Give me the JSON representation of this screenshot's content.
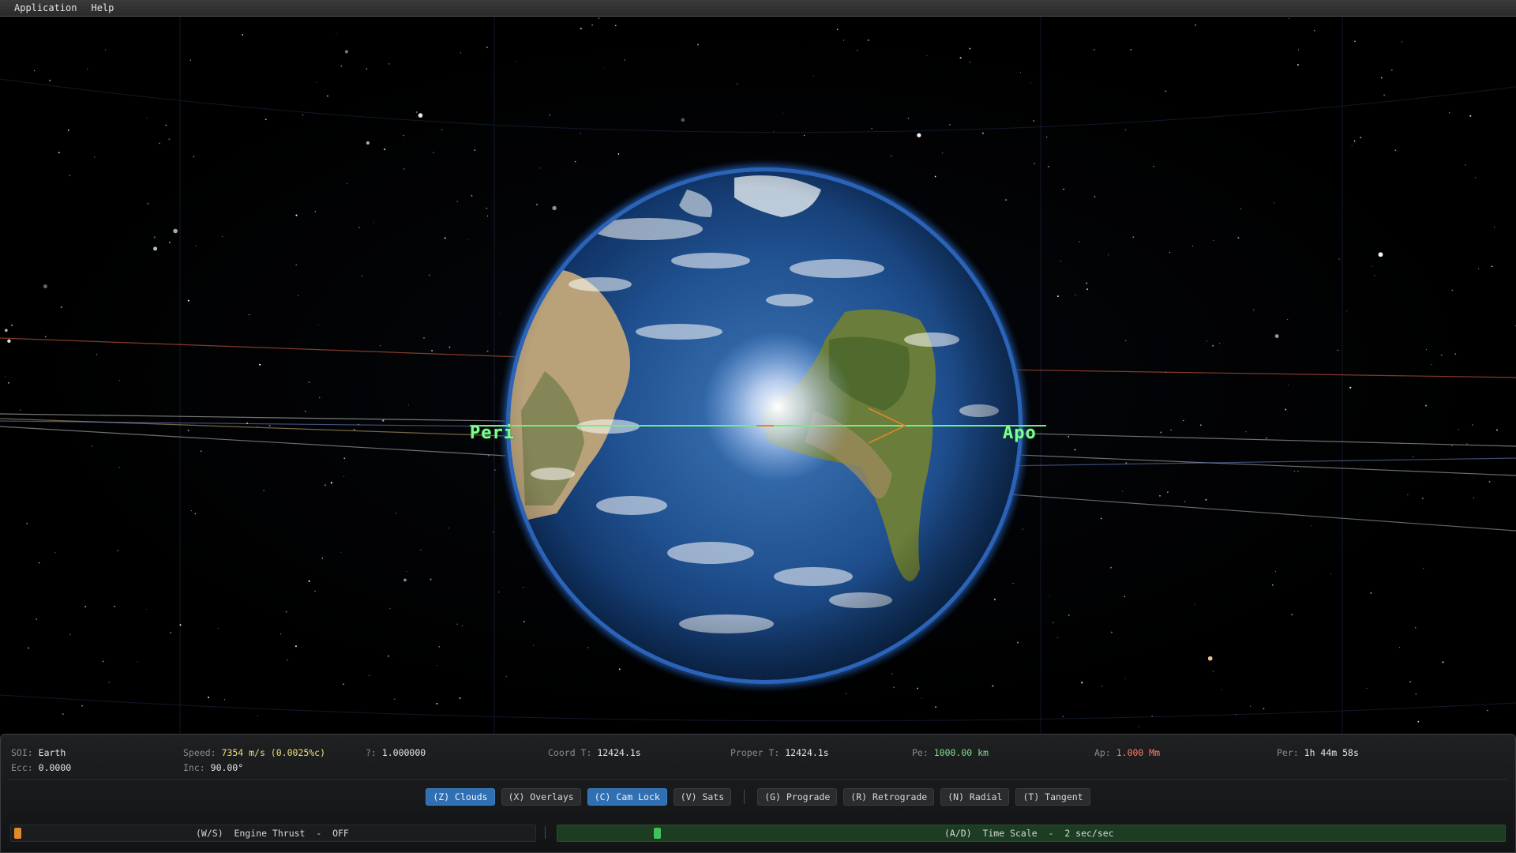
{
  "menu": {
    "items": [
      "Application",
      "Help"
    ]
  },
  "viewport": {
    "body": "Earth",
    "periapsis_label": "Peri",
    "apoapsis_label": "Apo"
  },
  "stats": {
    "soi": {
      "key": "SOI:",
      "value": "Earth"
    },
    "ecc": {
      "key": "Ecc:",
      "value": "0.0000"
    },
    "speed": {
      "key": "Speed:",
      "value": "7354 m/s (0.0025%c)"
    },
    "inc": {
      "key": "Inc:",
      "value": "90.00°"
    },
    "gamma": {
      "key": "?:",
      "value": "1.000000"
    },
    "coord_t": {
      "key": "Coord T:",
      "value": "12424.1s"
    },
    "proper_t": {
      "key": "Proper T:",
      "value": "12424.1s"
    },
    "pe": {
      "key": "Pe:",
      "value": "1000.00 km"
    },
    "ap": {
      "key": "Ap:",
      "value": "1.000 Mm"
    },
    "per": {
      "key": "Per:",
      "value": "1h 44m 58s"
    }
  },
  "toggles": [
    {
      "label": "(Z) Clouds",
      "active": true
    },
    {
      "label": "(X) Overlays",
      "active": false
    },
    {
      "label": "(C) Cam Lock",
      "active": true
    },
    {
      "label": "(V) Sats",
      "active": false
    }
  ],
  "maneuvers": [
    {
      "label": "(G) Prograde"
    },
    {
      "label": "(R) Retrograde"
    },
    {
      "label": "(N) Radial"
    },
    {
      "label": "(T) Tangent"
    }
  ],
  "engine": {
    "label": "(W/S)  Engine Thrust  -  OFF",
    "level": 0.0
  },
  "time_scale": {
    "label": "(A/D)  Time Scale  -  2 sec/sec",
    "level": 0.1
  },
  "colors": {
    "orbit_line": "#6ef07e",
    "toggle_active": "#2f6fb2",
    "thrust_knob": "#e08a2a",
    "timescale_fill": "#1c3d22",
    "timescale_knob": "#3fc25c"
  }
}
